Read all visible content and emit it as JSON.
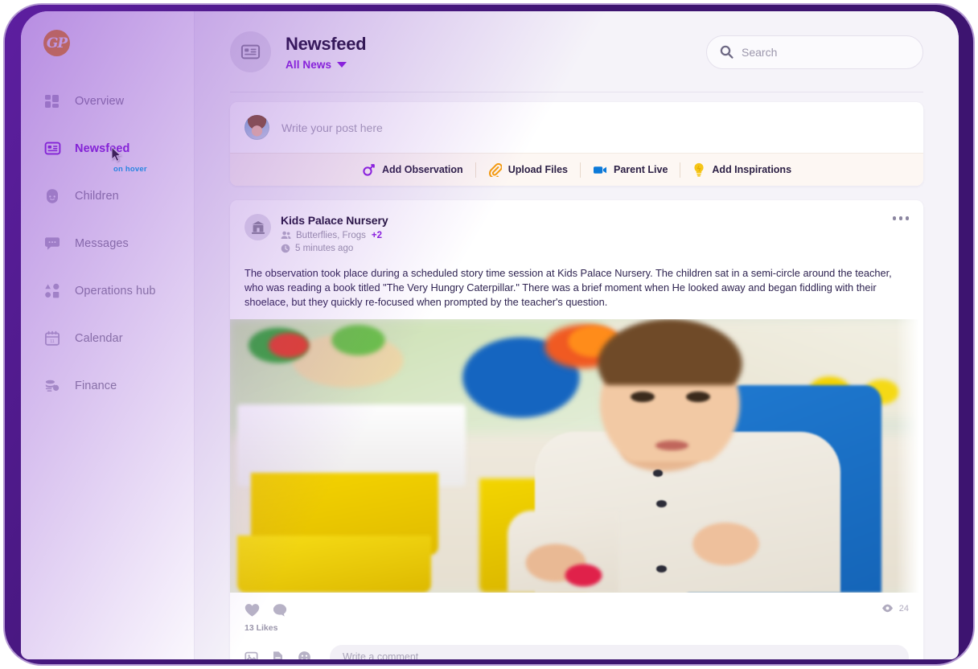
{
  "app": {
    "logo_text": "GP",
    "brand_color": "#8c1fe0",
    "accent_orange": "#f59b0b",
    "frame_color": "#3d1470"
  },
  "sidebar": {
    "items": [
      {
        "label": "Overview",
        "icon": "grid-icon",
        "active": false
      },
      {
        "label": "Newsfeed",
        "icon": "newspaper-icon",
        "active": true
      },
      {
        "label": "Children",
        "icon": "child-icon",
        "active": false
      },
      {
        "label": "Messages",
        "icon": "chat-icon",
        "active": false
      },
      {
        "label": "Operations hub",
        "icon": "shapes-icon",
        "active": false
      },
      {
        "label": "Calendar",
        "icon": "calendar-icon",
        "active": false
      },
      {
        "label": "Finance",
        "icon": "finance-icon",
        "active": false
      }
    ],
    "hover_note": "on hover",
    "hover_note_color": "#00b7ef"
  },
  "header": {
    "icon": "newspaper-icon",
    "title": "Newsfeed",
    "filter_label": "All News",
    "filter_icon": "chevron-down-icon"
  },
  "search": {
    "icon": "search-icon",
    "placeholder": "Search",
    "value": ""
  },
  "composer": {
    "avatar": "user-avatar",
    "placeholder": "Write your post here",
    "value": "",
    "actions": [
      {
        "label": "Add Observation",
        "icon": "observation-icon",
        "color": "#8c1fe0"
      },
      {
        "label": "Upload Files",
        "icon": "paperclip-icon",
        "color": "#f59b0b"
      },
      {
        "label": "Parent Live",
        "icon": "video-icon",
        "color": "#0c7ad9"
      },
      {
        "label": "Add Inspirations",
        "icon": "lightbulb-icon",
        "color": "#f5c518"
      }
    ]
  },
  "post": {
    "avatar_icon": "nursery-building-icon",
    "author": "Kids Palace Nursery",
    "rooms_icon": "people-icon",
    "rooms": "Butterflies, Frogs",
    "rooms_extra": "+2",
    "time_icon": "clock-icon",
    "time": "5 minutes ago",
    "menu_icon": "more-options-icon",
    "body": "The observation took place during a scheduled story time session at Kids Palace Nursery. The children sat in a semi-circle around the teacher, who was reading a book titled \"The Very Hungry Caterpillar.\" There was a brief moment when He looked away and began fiddling with their shoelace, but they quickly re-focused when prompted by the teacher's question.",
    "photo_alt": "Toddler boy playing with toy blocks in a nursery playroom",
    "like_icon": "heart-icon",
    "comment_icon": "comment-icon",
    "likes": "13 Likes",
    "views_icon": "eye-icon",
    "views": "24",
    "comment_tools": [
      {
        "icon": "image-icon"
      },
      {
        "icon": "file-icon"
      },
      {
        "icon": "emoji-icon"
      }
    ],
    "comment_placeholder": "Write a comment",
    "comment_value": ""
  }
}
